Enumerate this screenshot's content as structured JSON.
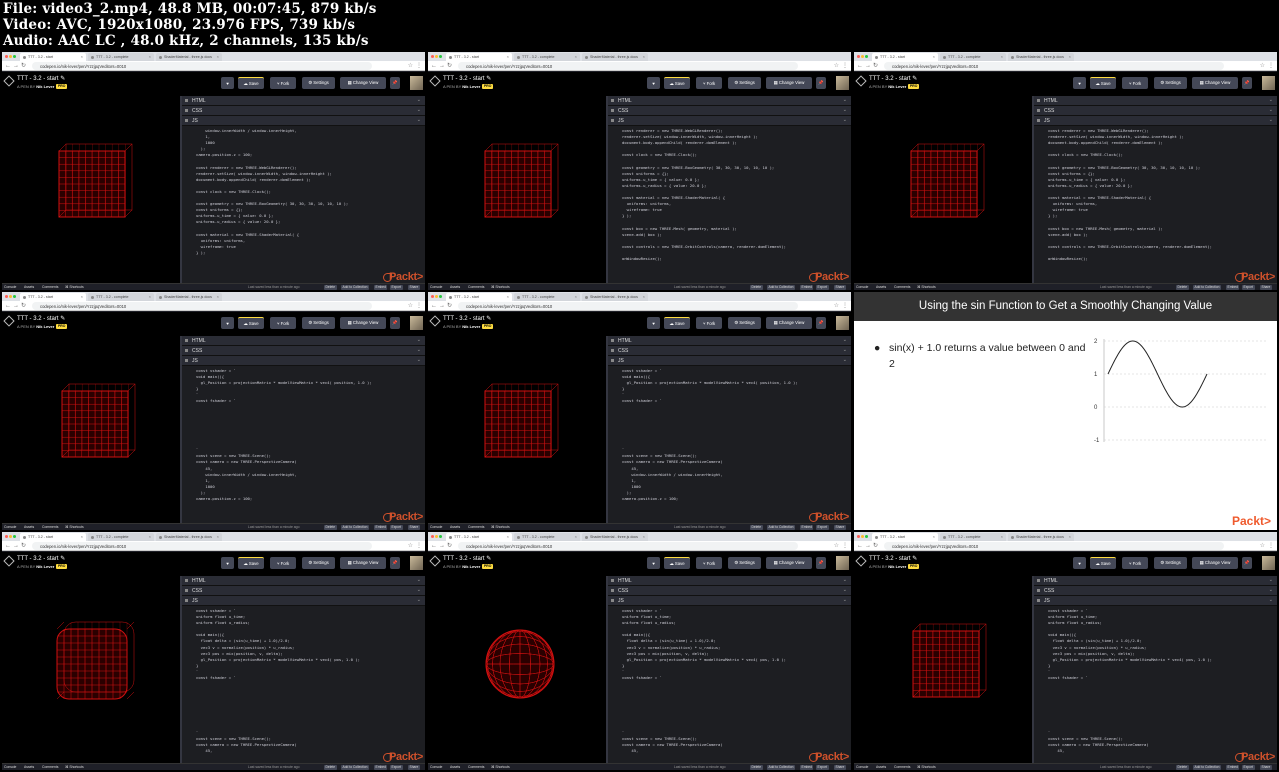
{
  "header": {
    "file": "File: video3_2.mp4, 48.8 MB, 00:07:45, 879 kb/s",
    "video": "Video: AVC, 1920x1080, 23.976 FPS, 739 kb/s",
    "audio": "Audio: AAC LC , 48.0 kHz, 2 channels, 135 kb/s"
  },
  "browser": {
    "tabs": [
      "TTT - 3.2 - start",
      "TTT - 3.2 - complete",
      "ShaderMaterial - three.js docs"
    ],
    "url": "codepen.io/nik-lever/pen/YzzjpqVeditors=0010"
  },
  "codepen": {
    "title": "TTT - 3.2 - start ✎",
    "author_prefix": "A PEN BY",
    "author": "Nik Lever",
    "pro": "PRO",
    "buttons": {
      "love": "♥",
      "save": "☁ Save",
      "fork": "⑂ Fork",
      "settings": "⚙ Settings",
      "change_view": "▦ Change View",
      "pin": "📌"
    },
    "panels": {
      "html": "HTML",
      "css": "CSS",
      "js": "JS"
    },
    "footer": {
      "console": "Console",
      "assets": "Assets",
      "comments": "Comments",
      "shortcuts": "⌘ Shortcuts",
      "saved": "Last saved less than a minute ago",
      "delete": "Delete",
      "collection": "Add to Collection",
      "embed": "Embed",
      "export": "Export",
      "share": "Share"
    }
  },
  "packt": "Packt>",
  "frames": [
    {
      "name": "frame-1",
      "code": [
        "    window.innerWidth / window.innerHeight,",
        "    1,",
        "    1000",
        "  );",
        "camera.position.z = 100;",
        "",
        "const renderer = new THREE.WebGLRenderer();",
        "renderer.setSize( window.innerWidth, window.innerHeight );",
        "document.body.appendChild( renderer.domElement );",
        "",
        "const clock = new THREE.Clock();",
        "",
        "const geometry = new THREE.BoxGeometry( 30, 30, 30, 10, 10, 10 );",
        "const uniforms = {};",
        "uniforms.u_time = { value: 0.0 };",
        "uniforms.u_radius = { value: 20.0 };",
        "",
        "const material = new THREE.ShaderMaterial( {",
        "  uniforms: uniforms,",
        "  wireframe: true",
        "} );"
      ]
    },
    {
      "name": "frame-2",
      "code": [
        "const renderer = new THREE.WebGLRenderer();",
        "renderer.setSize( window.innerWidth, window.innerHeight );",
        "document.body.appendChild( renderer.domElement );",
        "",
        "const clock = new THREE.Clock();",
        "",
        "const geometry = new THREE.BoxGeometry( 30, 30, 30, 10, 10, 10 );",
        "const uniforms = {};",
        "uniforms.u_time = { value: 0.0 };",
        "uniforms.u_radius = { value: 20.0 };",
        "",
        "const material = new THREE.ShaderMaterial( {",
        "  uniforms: uniforms,",
        "  wireframe: true",
        "} );",
        "",
        "const box = new THREE.Mesh( geometry, material );",
        "scene.add( box );",
        "",
        "const controls = new THREE.OrbitControls(camera, renderer.domElement);",
        "",
        "onWindowResize();"
      ]
    },
    {
      "name": "frame-3",
      "code": [
        "const renderer = new THREE.WebGLRenderer();",
        "renderer.setSize( window.innerWidth, window.innerHeight );",
        "document.body.appendChild( renderer.domElement );",
        "",
        "const clock = new THREE.Clock();",
        "",
        "const geometry = new THREE.BoxGeometry( 30, 30, 30, 10, 10, 10 );",
        "const uniforms = {};",
        "uniforms.u_time = { value: 0.0 };",
        "uniforms.u_radius = { value: 20.0 };",
        "",
        "const material = new THREE.ShaderMaterial( {",
        "  uniforms: uniforms,",
        "  wireframe: true",
        "} );",
        "",
        "const box = new THREE.Mesh( geometry, material );",
        "scene.add( box );",
        "",
        "const controls = new THREE.OrbitControls(camera, renderer.domElement);",
        "",
        "onWindowResize();"
      ]
    },
    {
      "name": "frame-4",
      "code": [
        "const vshader = `",
        "void main(){",
        "  gl_Position = projectionMatrix * modelViewMatrix * vec4( position, 1.0 );",
        "}",
        "`",
        "const fshader = `",
        "",
        "",
        "",
        "",
        "",
        "",
        "",
        "`",
        "const scene = new THREE.Scene();",
        "const camera = new THREE.PerspectiveCamera(",
        "    45,",
        "    window.innerWidth / window.innerHeight,",
        "    1,",
        "    1000",
        "  );",
        "camera.position.z = 100;"
      ]
    },
    {
      "name": "frame-5",
      "code": [
        "const vshader = `",
        "void main(){",
        "  gl_Position = projectionMatrix * modelViewMatrix * vec4( position, 1.0 );",
        "}",
        "`",
        "const fshader = `",
        "",
        "",
        "",
        "",
        "",
        "",
        "",
        "`",
        "const scene = new THREE.Scene();",
        "const camera = new THREE.PerspectiveCamera(",
        "    45,",
        "    window.innerWidth / window.innerHeight,",
        "    1,",
        "    1000",
        "  );",
        "camera.position.z = 100;"
      ]
    },
    {
      "name": "frame-7",
      "code": [
        "const vshader = `",
        "uniform float u_time;",
        "uniform float u_radius;",
        "",
        "void main(){",
        "  float delta = (sin(u_time) + 1.0)/2.0;",
        "  vec3 v = normalize(position) * u_radius;",
        "  vec3 pos = mix(position, v, delta);",
        "  gl_Position = projectionMatrix * modelViewMatrix * vec4( pos, 1.0 );",
        "}",
        "`",
        "const fshader = `",
        "",
        "",
        "",
        "",
        "",
        "",
        "",
        "",
        "`",
        "const scene = new THREE.Scene();",
        "const camera = new THREE.PerspectiveCamera(",
        "    45,"
      ]
    },
    {
      "name": "frame-8",
      "code": [
        "const vshader = `",
        "uniform float u_time;",
        "uniform float u_radius;",
        "",
        "void main(){",
        "  float delta = (sin(u_time) + 1.0)/2.0;",
        "  vec3 v = normalize(position) * u_radius;",
        "  vec3 pos = mix(position, v, delta);",
        "  gl_Position = projectionMatrix * modelViewMatrix * vec4( pos, 1.0 );",
        "}",
        "`",
        "const fshader = `",
        "",
        "",
        "",
        "",
        "",
        "",
        "",
        "",
        "`",
        "const scene = new THREE.Scene();",
        "const camera = new THREE.PerspectiveCamera(",
        "    45,"
      ]
    },
    {
      "name": "frame-9",
      "code": [
        "const vshader = `",
        "uniform float u_time;",
        "uniform float u_radius;",
        "",
        "void main(){",
        "  float delta = (sin(u_time) + 1.0)/2.0;",
        "  vec3 v = normalize(position) * u_radius;",
        "  vec3 pos = mix(position, v, delta);",
        "  gl_Position = projectionMatrix * modelViewMatrix * vec4( pos, 1.0 );",
        "}",
        "`",
        "const fshader = `",
        "",
        "",
        "",
        "",
        "",
        "",
        "",
        "",
        "`",
        "const scene = new THREE.Scene();",
        "const camera = new THREE.PerspectiveCamera(",
        "    45,"
      ]
    }
  ],
  "slide": {
    "title": "Using the sin Function to Get a Smoothly Changing Value",
    "bullet": "sin(x) + 1.0 returns a value between 0 and 2",
    "ticks": [
      "2",
      "1",
      "0",
      "-1"
    ]
  },
  "colors": {
    "wire": "#d01010",
    "accent": "#ffdd40",
    "editor_bg": "#1d1e22",
    "packt": "#ef5a2d"
  }
}
